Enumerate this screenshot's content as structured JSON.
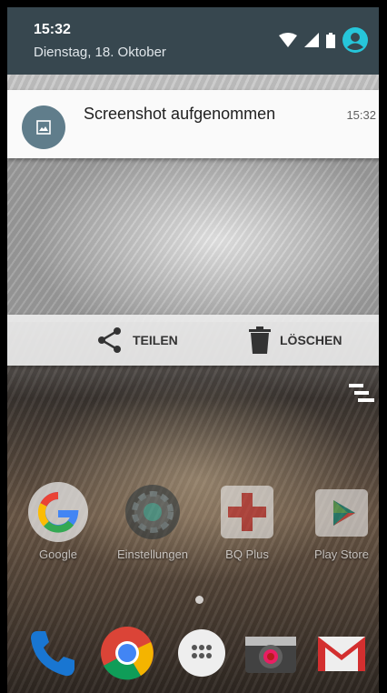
{
  "status": {
    "time": "15:32",
    "date": "Dienstag, 18. Oktober"
  },
  "notification": {
    "title": "Screenshot aufgenommen",
    "time": "15:32",
    "actions": {
      "share": "TEILEN",
      "delete": "LÖSCHEN"
    }
  },
  "apps": [
    {
      "label": "Google"
    },
    {
      "label": "Einstellungen"
    },
    {
      "label": "BQ Plus"
    },
    {
      "label": "Play Store"
    }
  ],
  "colors": {
    "header": "#37474f",
    "account": "#26c6da",
    "notif_icon_bg": "#607d8b"
  }
}
